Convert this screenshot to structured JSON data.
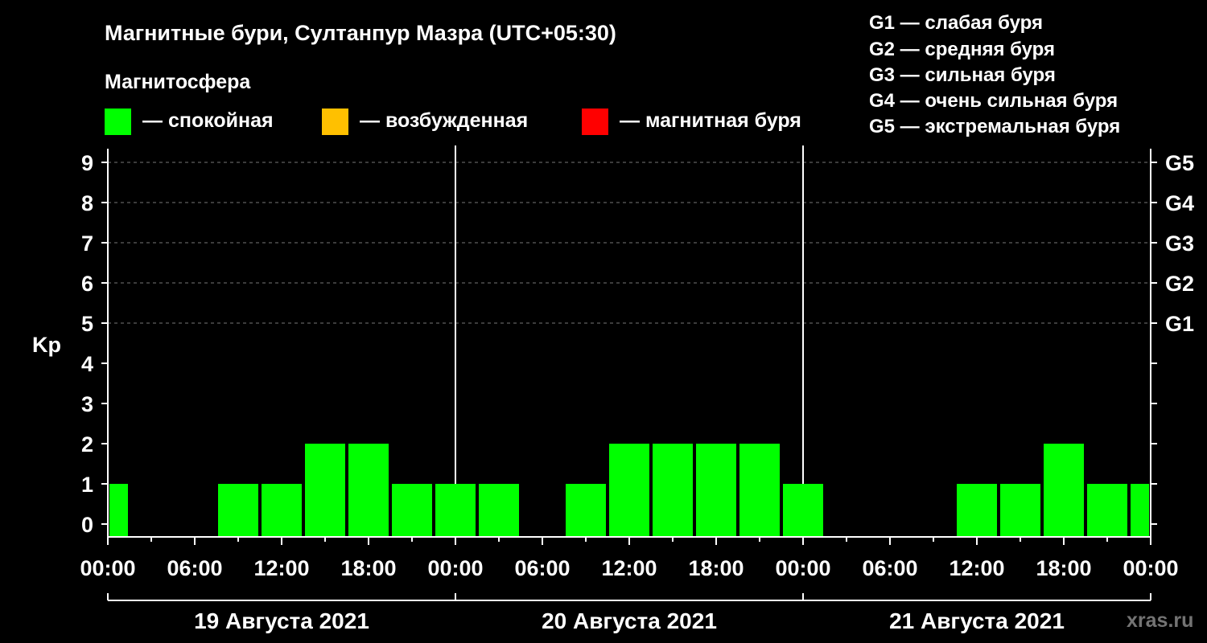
{
  "chart_data": {
    "type": "bar",
    "title": "Магнитные бури, Султанпур Мазра (UTC+05:30)",
    "ylabel": "Kp",
    "ylim": [
      0,
      9
    ],
    "grid": true,
    "legend": {
      "title": "Магнитосфера",
      "items": [
        {
          "label": "— спокойная",
          "color": "#00ff00"
        },
        {
          "label": "— возбужденная",
          "color": "#ffc000"
        },
        {
          "label": "— магнитная буря",
          "color": "#ff0000"
        }
      ]
    },
    "storm_scale": [
      "G1 — слабая буря",
      "G2 — средняя буря",
      "G3 — сильная буря",
      "G4 — очень сильная буря",
      "G5 — экстремальная буря"
    ],
    "right_axis": [
      {
        "kp": 5,
        "label": "G1"
      },
      {
        "kp": 6,
        "label": "G2"
      },
      {
        "kp": 7,
        "label": "G3"
      },
      {
        "kp": 8,
        "label": "G4"
      },
      {
        "kp": 9,
        "label": "G5"
      }
    ],
    "y_ticks": [
      "0",
      "1",
      "2",
      "3",
      "4",
      "5",
      "6",
      "7",
      "8",
      "9"
    ],
    "x_ticks": [
      "00:00",
      "06:00",
      "12:00",
      "18:00",
      "00:00",
      "06:00",
      "12:00",
      "18:00",
      "00:00",
      "06:00",
      "12:00",
      "18:00",
      "00:00"
    ],
    "days": [
      "19 Августа 2021",
      "20 Августа 2021",
      "21 Августа 2021"
    ],
    "bars": [
      {
        "start": "2021-08-19 00:00",
        "end": "2021-08-19 01:30",
        "kp": 1
      },
      {
        "start": "2021-08-19 01:30",
        "end": "2021-08-19 04:30",
        "kp": 0
      },
      {
        "start": "2021-08-19 04:30",
        "end": "2021-08-19 07:30",
        "kp": 0
      },
      {
        "start": "2021-08-19 07:30",
        "end": "2021-08-19 10:30",
        "kp": 1
      },
      {
        "start": "2021-08-19 10:30",
        "end": "2021-08-19 13:30",
        "kp": 1
      },
      {
        "start": "2021-08-19 13:30",
        "end": "2021-08-19 16:30",
        "kp": 2
      },
      {
        "start": "2021-08-19 16:30",
        "end": "2021-08-19 19:30",
        "kp": 2
      },
      {
        "start": "2021-08-19 19:30",
        "end": "2021-08-19 22:30",
        "kp": 1
      },
      {
        "start": "2021-08-19 22:30",
        "end": "2021-08-20 01:30",
        "kp": 1
      },
      {
        "start": "2021-08-20 01:30",
        "end": "2021-08-20 04:30",
        "kp": 1
      },
      {
        "start": "2021-08-20 04:30",
        "end": "2021-08-20 07:30",
        "kp": 0
      },
      {
        "start": "2021-08-20 07:30",
        "end": "2021-08-20 10:30",
        "kp": 1
      },
      {
        "start": "2021-08-20 10:30",
        "end": "2021-08-20 13:30",
        "kp": 2
      },
      {
        "start": "2021-08-20 13:30",
        "end": "2021-08-20 16:30",
        "kp": 2
      },
      {
        "start": "2021-08-20 16:30",
        "end": "2021-08-20 19:30",
        "kp": 2
      },
      {
        "start": "2021-08-20 19:30",
        "end": "2021-08-20 22:30",
        "kp": 2
      },
      {
        "start": "2021-08-20 22:30",
        "end": "2021-08-21 01:30",
        "kp": 1
      },
      {
        "start": "2021-08-21 01:30",
        "end": "2021-08-21 04:30",
        "kp": 0
      },
      {
        "start": "2021-08-21 04:30",
        "end": "2021-08-21 07:30",
        "kp": 0
      },
      {
        "start": "2021-08-21 07:30",
        "end": "2021-08-21 10:30",
        "kp": 0
      },
      {
        "start": "2021-08-21 10:30",
        "end": "2021-08-21 13:30",
        "kp": 1
      },
      {
        "start": "2021-08-21 13:30",
        "end": "2021-08-21 16:30",
        "kp": 1
      },
      {
        "start": "2021-08-21 16:30",
        "end": "2021-08-21 19:30",
        "kp": 2
      },
      {
        "start": "2021-08-21 19:30",
        "end": "2021-08-21 22:30",
        "kp": 1
      },
      {
        "start": "2021-08-21 22:30",
        "end": "2021-08-22 00:00",
        "kp": 1
      }
    ]
  },
  "footer": {
    "watermark": "xras.ru"
  }
}
